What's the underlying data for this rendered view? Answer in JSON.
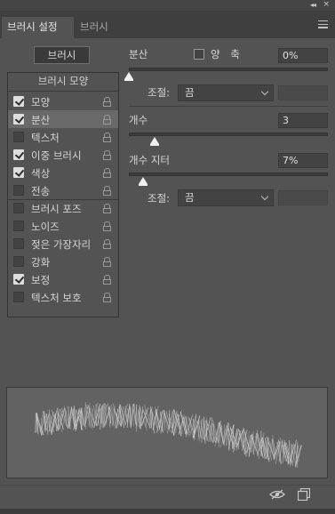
{
  "panel": {
    "tabs": [
      {
        "label": "브러시 설정",
        "active": true
      },
      {
        "label": "브러시",
        "active": false
      }
    ],
    "collapse_glyph": "◂◂",
    "close_glyph": "×"
  },
  "brushes_button": "브러시",
  "brush_tip_shape_header": "브러시 모양",
  "sections": [
    {
      "label": "모양",
      "checked": true,
      "locked": true,
      "selected": false
    },
    {
      "label": "분산",
      "checked": true,
      "locked": true,
      "selected": true
    },
    {
      "label": "텍스처",
      "checked": false,
      "locked": true,
      "selected": false
    },
    {
      "label": "이중 브러시",
      "checked": true,
      "locked": true,
      "selected": false
    },
    {
      "label": "색상",
      "checked": true,
      "locked": true,
      "selected": false
    },
    {
      "label": "전송",
      "checked": false,
      "locked": true,
      "selected": false
    },
    {
      "label": "브러시 포즈",
      "checked": false,
      "locked": true,
      "selected": false
    },
    {
      "label": "노이즈",
      "checked": false,
      "locked": true,
      "selected": false
    },
    {
      "label": "젖은 가장자리",
      "checked": false,
      "locked": true,
      "selected": false
    },
    {
      "label": "강화",
      "checked": false,
      "locked": true,
      "selected": false
    },
    {
      "label": "보정",
      "checked": true,
      "locked": true,
      "selected": false
    },
    {
      "label": "텍스처 보호",
      "checked": false,
      "locked": true,
      "selected": false
    }
  ],
  "scatter": {
    "label": "분산",
    "both_axes_label": "양 축",
    "both_axes_checked": false,
    "value": "0%",
    "slider_fraction": 0.0,
    "control_label": "조절:",
    "control_value": "끔"
  },
  "count": {
    "label": "개수",
    "value": "3",
    "slider_fraction": 0.13
  },
  "count_jitter": {
    "label": "개수 지터",
    "value": "7%",
    "slider_fraction": 0.07,
    "control_label": "조절:",
    "control_value": "끔"
  },
  "icons": {
    "eye": "eye-toggle-icon",
    "new_brush": "new-brush-icon",
    "lock": "lock-icon",
    "menu": "panel-menu-icon"
  },
  "colors": {
    "panel_bg": "#535353",
    "selected_row": "#696969",
    "field_bg": "#434343",
    "preview_bg": "#626262"
  }
}
